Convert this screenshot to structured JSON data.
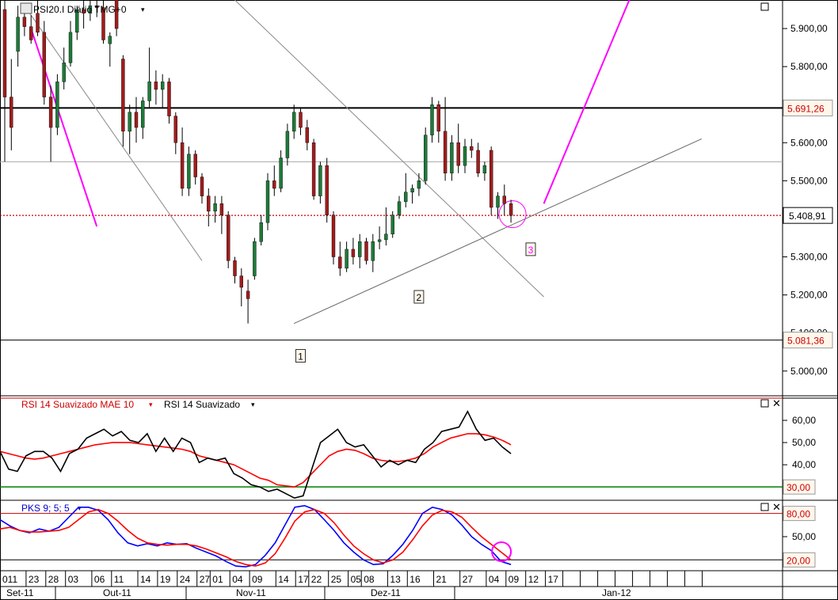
{
  "chart_data": [
    {
      "type": "candlestick",
      "title": "PSI20.I Diário TMG+0",
      "ylim": [
        4935,
        5975
      ],
      "y_ticks": [
        "5.900,00",
        "5.800,00",
        "5.700,00",
        "5.600,00",
        "5.500,00",
        "5.400,00",
        "5.300,00",
        "5.200,00",
        "5.100,00",
        "5.000,00"
      ],
      "y_tick_values": [
        5900,
        5800,
        5700,
        5600,
        5500,
        5400,
        5300,
        5200,
        5100,
        5000
      ],
      "price_tags": [
        {
          "value": 5691.26,
          "label": "5.691,26",
          "kind": "support"
        },
        {
          "value": 5408.91,
          "label": "5.408,91",
          "kind": "last"
        },
        {
          "value": 5081.36,
          "label": "5.081,36",
          "kind": "support"
        }
      ],
      "grey_level": 5550,
      "wave_labels": [
        "1",
        "2",
        "3"
      ],
      "candles": [
        {
          "o": 5950,
          "h": 5975,
          "l": 5550,
          "c": 5720
        },
        {
          "o": 5720,
          "h": 5820,
          "l": 5580,
          "c": 5640
        },
        {
          "o": 5840,
          "h": 5960,
          "l": 5800,
          "c": 5930
        },
        {
          "o": 5930,
          "h": 5960,
          "l": 5880,
          "c": 5905
        },
        {
          "o": 5905,
          "h": 5935,
          "l": 5860,
          "c": 5870
        },
        {
          "o": 5940,
          "h": 5975,
          "l": 5880,
          "c": 5890
        },
        {
          "o": 5890,
          "h": 5920,
          "l": 5700,
          "c": 5720
        },
        {
          "o": 5720,
          "h": 5750,
          "l": 5550,
          "c": 5640
        },
        {
          "o": 5640,
          "h": 5780,
          "l": 5620,
          "c": 5760
        },
        {
          "o": 5760,
          "h": 5850,
          "l": 5740,
          "c": 5810
        },
        {
          "o": 5810,
          "h": 5920,
          "l": 5800,
          "c": 5890
        },
        {
          "o": 5890,
          "h": 5960,
          "l": 5870,
          "c": 5950
        },
        {
          "o": 5950,
          "h": 5975,
          "l": 5900,
          "c": 5940
        },
        {
          "o": 5940,
          "h": 5975,
          "l": 5920,
          "c": 5960
        },
        {
          "o": 5960,
          "h": 5975,
          "l": 5930,
          "c": 5955
        },
        {
          "o": 5955,
          "h": 5975,
          "l": 5860,
          "c": 5870
        },
        {
          "o": 5860,
          "h": 5890,
          "l": 5800,
          "c": 5880
        },
        {
          "o": 5975,
          "h": 5975,
          "l": 5880,
          "c": 5900
        },
        {
          "o": 5820,
          "h": 5830,
          "l": 5590,
          "c": 5630
        },
        {
          "o": 5630,
          "h": 5700,
          "l": 5570,
          "c": 5680
        },
        {
          "o": 5680,
          "h": 5720,
          "l": 5600,
          "c": 5640
        },
        {
          "o": 5640,
          "h": 5720,
          "l": 5610,
          "c": 5710
        },
        {
          "o": 5710,
          "h": 5850,
          "l": 5690,
          "c": 5760
        },
        {
          "o": 5760,
          "h": 5790,
          "l": 5700,
          "c": 5740
        },
        {
          "o": 5740,
          "h": 5780,
          "l": 5690,
          "c": 5760
        },
        {
          "o": 5760,
          "h": 5770,
          "l": 5650,
          "c": 5670
        },
        {
          "o": 5670,
          "h": 5680,
          "l": 5570,
          "c": 5600
        },
        {
          "o": 5600,
          "h": 5640,
          "l": 5460,
          "c": 5480
        },
        {
          "o": 5480,
          "h": 5590,
          "l": 5460,
          "c": 5570
        },
        {
          "o": 5570,
          "h": 5580,
          "l": 5490,
          "c": 5510
        },
        {
          "o": 5510,
          "h": 5520,
          "l": 5440,
          "c": 5460
        },
        {
          "o": 5460,
          "h": 5480,
          "l": 5380,
          "c": 5420
        },
        {
          "o": 5420,
          "h": 5460,
          "l": 5390,
          "c": 5440
        },
        {
          "o": 5440,
          "h": 5460,
          "l": 5360,
          "c": 5410
        },
        {
          "o": 5410,
          "h": 5420,
          "l": 5270,
          "c": 5290
        },
        {
          "o": 5290,
          "h": 5300,
          "l": 5230,
          "c": 5250
        },
        {
          "o": 5250,
          "h": 5270,
          "l": 5170,
          "c": 5220
        },
        {
          "o": 5210,
          "h": 5240,
          "l": 5125,
          "c": 5190
        },
        {
          "o": 5250,
          "h": 5350,
          "l": 5240,
          "c": 5340
        },
        {
          "o": 5340,
          "h": 5410,
          "l": 5330,
          "c": 5390
        },
        {
          "o": 5390,
          "h": 5520,
          "l": 5370,
          "c": 5500
        },
        {
          "o": 5500,
          "h": 5540,
          "l": 5460,
          "c": 5480
        },
        {
          "o": 5480,
          "h": 5580,
          "l": 5470,
          "c": 5560
        },
        {
          "o": 5560,
          "h": 5650,
          "l": 5540,
          "c": 5630
        },
        {
          "o": 5630,
          "h": 5700,
          "l": 5610,
          "c": 5680
        },
        {
          "o": 5680,
          "h": 5690,
          "l": 5620,
          "c": 5640
        },
        {
          "o": 5640,
          "h": 5660,
          "l": 5580,
          "c": 5600
        },
        {
          "o": 5600,
          "h": 5610,
          "l": 5450,
          "c": 5460
        },
        {
          "o": 5460,
          "h": 5550,
          "l": 5440,
          "c": 5540
        },
        {
          "o": 5540,
          "h": 5560,
          "l": 5390,
          "c": 5410
        },
        {
          "o": 5410,
          "h": 5420,
          "l": 5280,
          "c": 5300
        },
        {
          "o": 5300,
          "h": 5340,
          "l": 5250,
          "c": 5270
        },
        {
          "o": 5270,
          "h": 5340,
          "l": 5260,
          "c": 5320
        },
        {
          "o": 5320,
          "h": 5350,
          "l": 5280,
          "c": 5300
        },
        {
          "o": 5300,
          "h": 5360,
          "l": 5270,
          "c": 5340
        },
        {
          "o": 5340,
          "h": 5350,
          "l": 5280,
          "c": 5290
        },
        {
          "o": 5290,
          "h": 5360,
          "l": 5260,
          "c": 5340
        },
        {
          "o": 5340,
          "h": 5380,
          "l": 5320,
          "c": 5345
        },
        {
          "o": 5345,
          "h": 5430,
          "l": 5330,
          "c": 5360
        },
        {
          "o": 5360,
          "h": 5420,
          "l": 5350,
          "c": 5410
        },
        {
          "o": 5410,
          "h": 5460,
          "l": 5400,
          "c": 5445
        },
        {
          "o": 5445,
          "h": 5520,
          "l": 5430,
          "c": 5470
        },
        {
          "o": 5470,
          "h": 5490,
          "l": 5440,
          "c": 5480
        },
        {
          "o": 5480,
          "h": 5520,
          "l": 5460,
          "c": 5500
        },
        {
          "o": 5500,
          "h": 5640,
          "l": 5490,
          "c": 5620
        },
        {
          "o": 5620,
          "h": 5720,
          "l": 5600,
          "c": 5700
        },
        {
          "o": 5700,
          "h": 5710,
          "l": 5600,
          "c": 5630
        },
        {
          "o": 5630,
          "h": 5720,
          "l": 5500,
          "c": 5520
        },
        {
          "o": 5520,
          "h": 5620,
          "l": 5500,
          "c": 5600
        },
        {
          "o": 5600,
          "h": 5650,
          "l": 5520,
          "c": 5540
        },
        {
          "o": 5540,
          "h": 5610,
          "l": 5520,
          "c": 5590
        },
        {
          "o": 5590,
          "h": 5610,
          "l": 5560,
          "c": 5580
        },
        {
          "o": 5580,
          "h": 5600,
          "l": 5510,
          "c": 5520
        },
        {
          "o": 5520,
          "h": 5550,
          "l": 5500,
          "c": 5540
        },
        {
          "o": 5580,
          "h": 5590,
          "l": 5410,
          "c": 5430
        },
        {
          "o": 5430,
          "h": 5470,
          "l": 5400,
          "c": 5460
        },
        {
          "o": 5460,
          "h": 5490,
          "l": 5410,
          "c": 5440
        },
        {
          "o": 5440,
          "h": 5450,
          "l": 5390,
          "c": 5408.91
        }
      ]
    },
    {
      "type": "line",
      "title": "RSI 14 Suavizado",
      "ylim": [
        24,
        70
      ],
      "y_ticks": [
        "60,00",
        "50,00",
        "40,00"
      ],
      "y_tick_values": [
        60,
        50,
        40
      ],
      "levels": [
        {
          "value": 70,
          "color": "#cc0000"
        },
        {
          "value": 30,
          "color": "#008000",
          "label": "30,00"
        }
      ],
      "series": [
        {
          "name": "RSI 14 Suavizado MAE 10",
          "color": "#ff0000",
          "values": [
            46,
            45,
            44,
            43,
            42.5,
            43,
            44,
            45,
            46,
            47,
            48,
            49,
            49.5,
            50,
            50,
            50,
            49.5,
            49,
            48.5,
            48,
            47.5,
            47,
            46,
            44,
            43,
            42,
            41,
            40,
            38,
            36,
            34,
            33,
            31,
            30.5,
            30,
            32,
            36,
            40,
            44,
            46,
            47,
            46.5,
            45,
            43,
            42,
            41.5,
            41.5,
            42,
            43,
            45,
            48,
            50,
            52,
            53,
            54,
            54,
            53.5,
            52.5,
            51,
            49
          ]
        },
        {
          "name": "RSI 14 Suavizado",
          "color": "#000000",
          "values": [
            46,
            38,
            37,
            44,
            46,
            46,
            43,
            37,
            45,
            47,
            52,
            54,
            56,
            53,
            55,
            51,
            50,
            54,
            46,
            52,
            46,
            52,
            50,
            41,
            43,
            42,
            43,
            36,
            34,
            31,
            30,
            28,
            29,
            27,
            25,
            26,
            38,
            50,
            53,
            56,
            50,
            48,
            49,
            44,
            39,
            42,
            40,
            42,
            41,
            47,
            50,
            55,
            56,
            57,
            64,
            56,
            51,
            52,
            48,
            45
          ]
        }
      ]
    },
    {
      "type": "line",
      "title": "PKS 9; 5; 5",
      "ylim": [
        6,
        97
      ],
      "y_ticks": [
        "80,00",
        "50,00",
        "20,00"
      ],
      "y_tick_values": [
        80,
        50,
        20
      ],
      "levels": [
        {
          "value": 80,
          "color": "#cc0000",
          "label": "80,00"
        },
        {
          "value": 20,
          "color": "#000000",
          "label": "20,00"
        }
      ],
      "series": [
        {
          "name": "PKS 9; 5; 5",
          "color": "#0000ff",
          "values": [
            72,
            64,
            58,
            55,
            60,
            57,
            62,
            75,
            88,
            88,
            84,
            72,
            55,
            42,
            38,
            41,
            38,
            42,
            40,
            41,
            35,
            30,
            25,
            18,
            12,
            11,
            14,
            26,
            42,
            65,
            88,
            90,
            85,
            72,
            58,
            42,
            30,
            20,
            14,
            15,
            26,
            40,
            58,
            80,
            88,
            85,
            78,
            65,
            50,
            40,
            32,
            18,
            14
          ]
        },
        {
          "name": "",
          "color": "#ff0000",
          "values": [
            60,
            62,
            58,
            56,
            56,
            57,
            58,
            62,
            72,
            82,
            85,
            80,
            70,
            58,
            48,
            42,
            40,
            39,
            40,
            40,
            38,
            34,
            29,
            24,
            18,
            14,
            12,
            16,
            28,
            48,
            70,
            82,
            85,
            80,
            68,
            52,
            38,
            28,
            20,
            16,
            20,
            30,
            46,
            64,
            78,
            84,
            82,
            75,
            62,
            50,
            40,
            30,
            20
          ]
        }
      ]
    }
  ],
  "x_axis": {
    "day_labels": [
      "011",
      "23",
      "28",
      "03",
      "06",
      "11",
      "14",
      "19",
      "24",
      "27",
      "01",
      "04",
      "09",
      "14",
      "17",
      "22",
      "25",
      "05",
      "08",
      "13",
      "16",
      "21",
      "27",
      "04",
      "09",
      "12",
      "17"
    ],
    "month_labels": [
      "Set-11",
      "Out-11",
      "Nov-11",
      "Dez-11",
      "Jan-12"
    ]
  },
  "panels": {
    "rsi_label_ma": "RSI 14 Suavizado MAE 10",
    "rsi_label": "RSI 14 Suavizado",
    "pks_label": "PKS 9; 5; 5"
  },
  "colors": {
    "bull": "#1e7a3a",
    "bear": "#a01c1c",
    "magenta": "#ff00ff",
    "tag_text": "#cc0000",
    "tag_bg": "#fff7ec"
  },
  "icons": [
    "maximize-icon",
    "close-icon",
    "dropdown-arrow-icon"
  ]
}
